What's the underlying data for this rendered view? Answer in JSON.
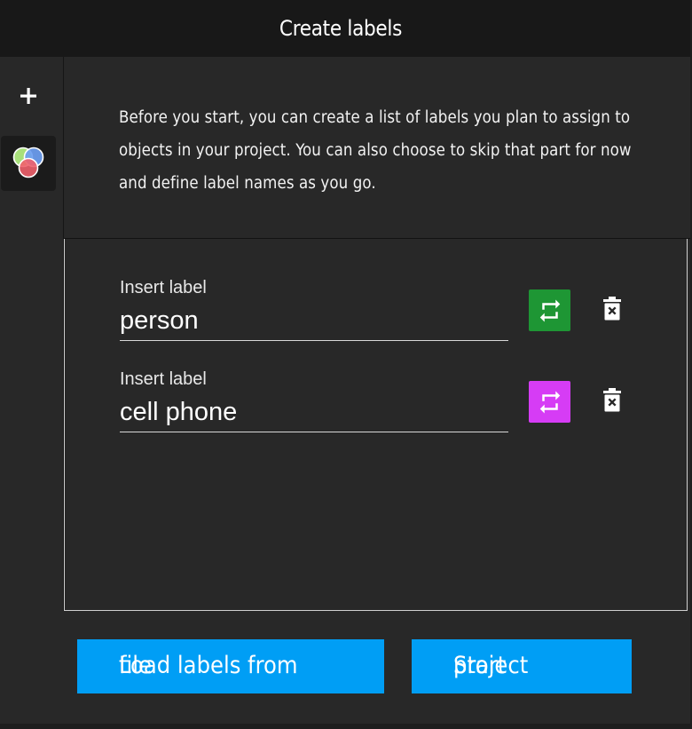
{
  "header": {
    "title": "Create labels"
  },
  "sidebar": {
    "add_icon": "plus-icon",
    "labels_tab_icon": "color-circles-icon"
  },
  "description": "Before you start, you can create a list of labels you plan to assign to objects in your project. You can also choose to skip that part for now and define label names as you go.",
  "labels": [
    {
      "caption": "Insert label",
      "value": "person",
      "color": "#1e9634",
      "color_icon": "repeat-icon",
      "delete_icon": "delete-icon"
    },
    {
      "caption": "Insert label",
      "value": "cell phone",
      "color": "#d63cf5",
      "color_icon": "repeat-icon",
      "delete_icon": "delete-icon"
    }
  ],
  "footer": {
    "load_button": {
      "text_a": "file",
      "text_b": "Load labels from"
    },
    "start_button": {
      "text_a": "Start",
      "text_b": "project"
    },
    "accent": "#009ef5"
  }
}
